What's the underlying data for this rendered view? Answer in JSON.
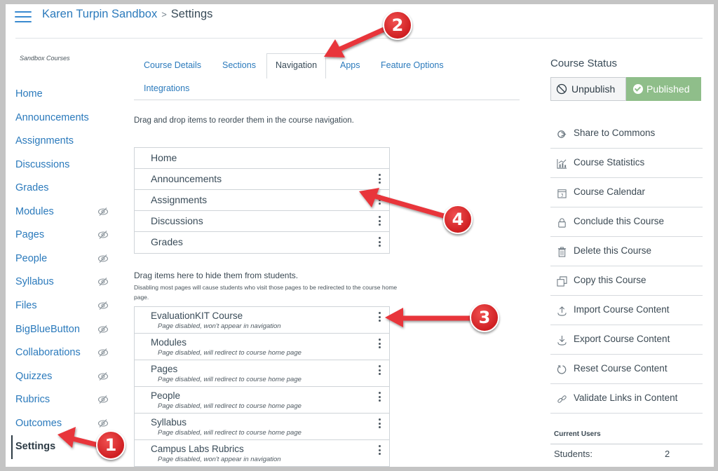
{
  "header": {
    "course_link": "Karen Turpin Sandbox",
    "separator": ">",
    "current_page": "Settings"
  },
  "leftnav": {
    "subtitle": "Sandbox Courses",
    "items": [
      {
        "label": "Home",
        "hidden": false
      },
      {
        "label": "Announcements",
        "hidden": false
      },
      {
        "label": "Assignments",
        "hidden": false
      },
      {
        "label": "Discussions",
        "hidden": false
      },
      {
        "label": "Grades",
        "hidden": false
      },
      {
        "label": "Modules",
        "hidden": true
      },
      {
        "label": "Pages",
        "hidden": true
      },
      {
        "label": "People",
        "hidden": true
      },
      {
        "label": "Syllabus",
        "hidden": true
      },
      {
        "label": "Files",
        "hidden": true
      },
      {
        "label": "BigBlueButton",
        "hidden": true
      },
      {
        "label": "Collaborations",
        "hidden": true
      },
      {
        "label": "Quizzes",
        "hidden": true
      },
      {
        "label": "Rubrics",
        "hidden": true
      },
      {
        "label": "Outcomes",
        "hidden": true
      },
      {
        "label": "Settings",
        "hidden": false,
        "active": true
      }
    ]
  },
  "tabs": [
    {
      "label": "Course Details"
    },
    {
      "label": "Sections"
    },
    {
      "label": "Navigation",
      "active": true
    },
    {
      "label": "Apps"
    },
    {
      "label": "Feature Options"
    },
    {
      "label": "Integrations"
    }
  ],
  "navigation": {
    "intro": "Drag and drop items to reorder them in the course navigation.",
    "enabled_items": [
      "Home",
      "Announcements",
      "Assignments",
      "Discussions",
      "Grades"
    ],
    "hidden_title": "Drag items here to hide them from students.",
    "hidden_note": "Disabling most pages will cause students who visit those pages to be redirected to the course home page.",
    "disabled_items": [
      {
        "name": "EvaluationKIT Course",
        "note": "Page disabled, won't appear in navigation"
      },
      {
        "name": "Modules",
        "note": "Page disabled, will redirect to course home page"
      },
      {
        "name": "Pages",
        "note": "Page disabled, will redirect to course home page"
      },
      {
        "name": "People",
        "note": "Page disabled, will redirect to course home page"
      },
      {
        "name": "Syllabus",
        "note": "Page disabled, will redirect to course home page"
      },
      {
        "name": "Campus Labs Rubrics",
        "note": "Page disabled, won't appear in navigation"
      }
    ]
  },
  "sidebar": {
    "status_title": "Course Status",
    "unpublish_label": "Unpublish",
    "published_label": "Published",
    "actions": [
      {
        "label": "Share to Commons",
        "icon": "commons-icon"
      },
      {
        "label": "Course Statistics",
        "icon": "statistics-icon"
      },
      {
        "label": "Course Calendar",
        "icon": "calendar-icon"
      },
      {
        "label": "Conclude this Course",
        "icon": "lock-icon"
      },
      {
        "label": "Delete this Course",
        "icon": "trash-icon"
      },
      {
        "label": "Copy this Course",
        "icon": "copy-icon"
      },
      {
        "label": "Import Course Content",
        "icon": "upload-icon"
      },
      {
        "label": "Export Course Content",
        "icon": "download-icon"
      },
      {
        "label": "Reset Course Content",
        "icon": "reset-icon"
      },
      {
        "label": "Validate Links in Content",
        "icon": "link-icon"
      }
    ],
    "current_users_title": "Current Users",
    "students_label": "Students:",
    "students_count": "2"
  },
  "annotations": [
    "1",
    "2",
    "3",
    "4"
  ],
  "colors": {
    "link": "#2b7abc",
    "published": "#8fbe8a",
    "annotation": "#e02b2e"
  }
}
